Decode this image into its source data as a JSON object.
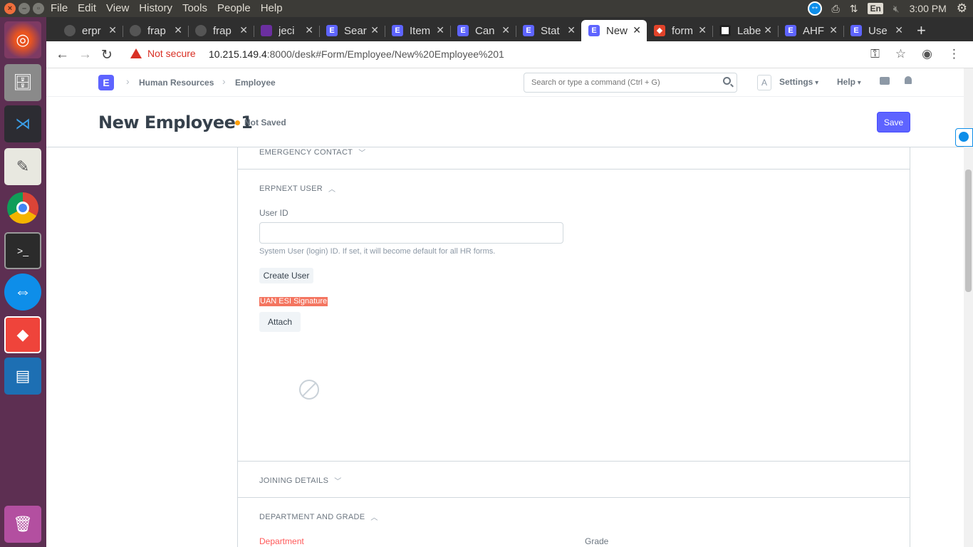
{
  "os": {
    "menus": [
      "File",
      "Edit",
      "View",
      "History",
      "Tools",
      "People",
      "Help"
    ],
    "lang": "En",
    "clock": "3:00 PM"
  },
  "tabs": [
    {
      "label": "erpr",
      "icon": "github-icon"
    },
    {
      "label": "frap",
      "icon": "github-icon"
    },
    {
      "label": "frap",
      "icon": "github-icon"
    },
    {
      "label": "jeci",
      "icon": "mail-icon"
    },
    {
      "label": "Sear",
      "icon": "erpnext-icon"
    },
    {
      "label": "Item",
      "icon": "erpnext-icon"
    },
    {
      "label": "Can",
      "icon": "erpnext-icon"
    },
    {
      "label": "Stat",
      "icon": "erpnext-icon"
    },
    {
      "label": "New",
      "icon": "erpnext-icon",
      "active": true
    },
    {
      "label": "form",
      "icon": "gitlab-icon"
    },
    {
      "label": "Labe",
      "icon": "label-icon"
    },
    {
      "label": "AHF",
      "icon": "erpnext-icon"
    },
    {
      "label": "Use",
      "icon": "erpnext-icon"
    }
  ],
  "address": {
    "warning": "Not secure",
    "host": "10.215.149.4",
    "path": ":8000/desk#Form/Employee/New%20Employee%201"
  },
  "navbar": {
    "logo": "E",
    "breadcrumbs": [
      "Human Resources",
      "Employee"
    ],
    "search_placeholder": "Search or type a command (Ctrl + G)",
    "avatar": "A",
    "settings": "Settings",
    "help": "Help"
  },
  "page": {
    "title": "New Employee 1",
    "status": "Not Saved",
    "save_label": "Save"
  },
  "form": {
    "emergency_contact": "EMERGENCY CONTACT",
    "erpnext_user": "ERPNEXT USER",
    "user_id_label": "User ID",
    "user_id_value": "",
    "user_id_desc": "System User (login) ID. If set, it will become default for all HR forms.",
    "create_user": "Create User",
    "signature_label": "UAN ESI Signature",
    "attach": "Attach",
    "joining_details": "JOINING DETAILS",
    "department_and_grade": "DEPARTMENT AND GRADE",
    "department_label": "Department",
    "grade_label": "Grade"
  },
  "colors": {
    "primary": "#5e64ff",
    "highlight": "#f47560",
    "required": "#ff5858",
    "unsaved_dot": "#ffa00a"
  }
}
